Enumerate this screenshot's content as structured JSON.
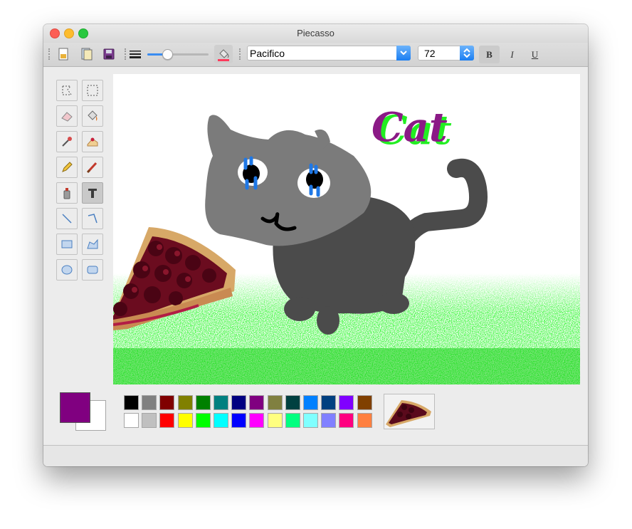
{
  "window": {
    "title": "Piecasso"
  },
  "toolbar": {
    "font_name": "Pacifico",
    "font_size": "72",
    "bold_label": "B",
    "italic_label": "I",
    "underline_label": "U",
    "brush_size_level": 0.3
  },
  "canvas": {
    "text": "Cat"
  },
  "colors": {
    "primary": "#800080",
    "secondary": "#ffffff",
    "palette_top": [
      "#000000",
      "#808080",
      "#800000",
      "#808000",
      "#008000",
      "#008080",
      "#000080",
      "#800080",
      "#808040",
      "#004040",
      "#0080ff",
      "#004080",
      "#8000ff",
      "#804000"
    ],
    "palette_bottom": [
      "#ffffff",
      "#c0c0c0",
      "#ff0000",
      "#ffff00",
      "#00ff00",
      "#00ffff",
      "#0000ff",
      "#ff00ff",
      "#ffff80",
      "#00ff80",
      "#80ffff",
      "#8080ff",
      "#ff0080",
      "#ff8040"
    ]
  }
}
